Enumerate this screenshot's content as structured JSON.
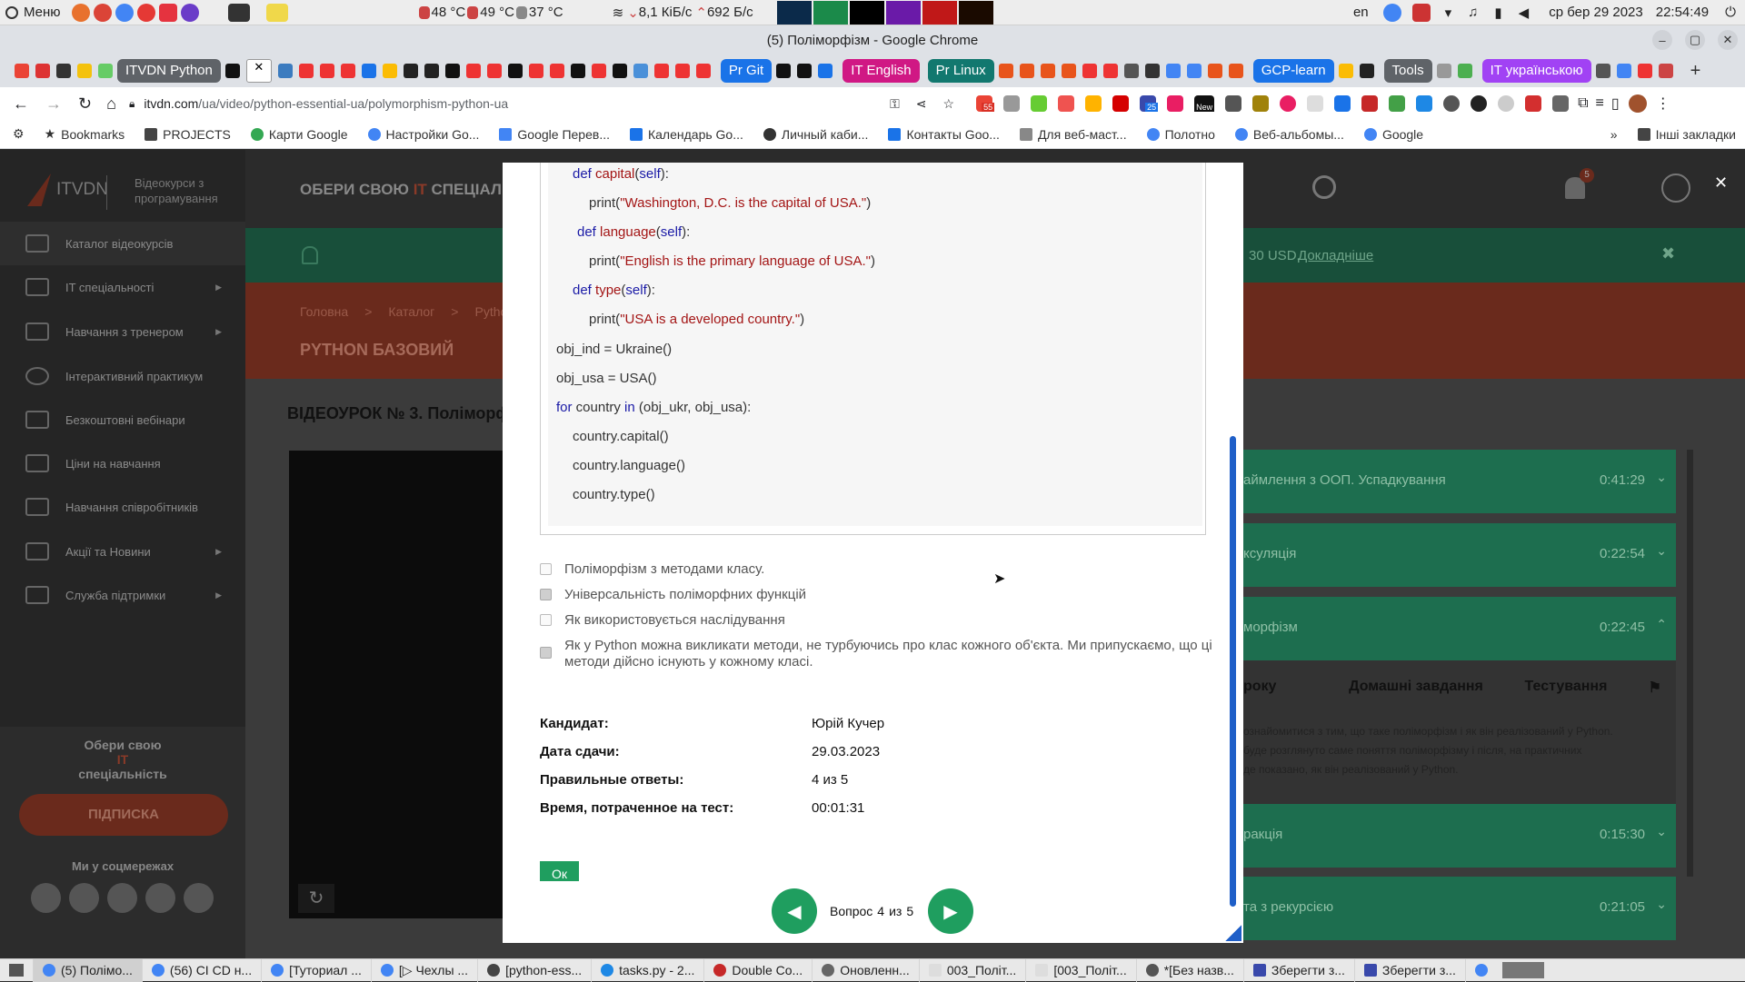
{
  "os_bar": {
    "menu_label": "Меню",
    "temp1": "48 °C",
    "temp2": "49 °C",
    "temp3": "37 °C",
    "net_down": "8,1 КіБ/с",
    "net_up": "692 Б/с",
    "lang": "en",
    "datetime": "ср бер 29 2023",
    "clock": "22:54:49"
  },
  "window": {
    "title": "(5) Поліморфізм - Google Chrome"
  },
  "tabs": {
    "itvdn_python": "ITVDN Python",
    "pr_git": "Pr Git",
    "it_english": "IT English",
    "pr_linux": "Pr Linux",
    "gcp_learn": "GCP-learn",
    "tools": "Tools",
    "it_ukr": "IT українською"
  },
  "address": {
    "host": "itvdn.com",
    "path": "/ua/video/python-essential-ua/polymorphism-python-ua",
    "badge_55": "55",
    "badge_25": "25",
    "badge_new": "New"
  },
  "bookmarks": {
    "items": [
      "Bookmarks",
      "PROJECTS",
      "Карти Google",
      "Настройки Go...",
      "Google Перев...",
      "Календарь Go...",
      "Личный каби...",
      "Контакты Goo...",
      "Для веб-маст...",
      "Полотно",
      "Веб-альбомы...",
      "Google"
    ],
    "more": "»",
    "other": "Інші закладки"
  },
  "site": {
    "logo": "ITVDN",
    "logo_sub": "Відеокурси з програмування",
    "choose_spec": "ОБЕРИ СВОЮ",
    "choose_it": "IT",
    "choose_rest": "СПЕЦІАЛЬН",
    "notif_count": "5",
    "promo_tail": "30 USD.",
    "promo_link": "Докладніше",
    "breadcrumb": [
      "Головна",
      "Каталог",
      "Python E"
    ],
    "course_title": "PYTHON БАЗОВИЙ",
    "lesson_title": "ВІДЕОУРОК № 3. Поліморфі",
    "sidebar": [
      "Каталог відеокурсів",
      "IT спеціальності",
      "Навчання з тренером",
      "Інтерактивний практикум",
      "Безкоштовні вебінари",
      "Ціни на навчання",
      "Навчання співробітників",
      "Акції та Новини",
      "Служба підтримки"
    ],
    "choose_block": [
      "Обери свою",
      "IT",
      "спеціальність"
    ],
    "subscribe": "ПІДПИСКА",
    "social_label": "Ми у соцмережах",
    "lessons": [
      {
        "title": "аймлення з ООП. Успадкування",
        "duration": "0:41:29"
      },
      {
        "title": "ксуляція",
        "duration": "0:22:54"
      },
      {
        "title": "морфізм",
        "duration": "0:22:45"
      },
      {
        "title": "ракція",
        "duration": "0:15:30"
      },
      {
        "title": "та з рекурсією",
        "duration": "0:21:05"
      }
    ],
    "lesson_tabs": [
      "року",
      "Домашні завдання",
      "Тестування"
    ],
    "lesson_desc": [
      "ознайомитися з тим, що таке поліморфізм і як він реалізований у Python.",
      "буде розглянуто саме поняття поліморфізму і після, на практичних",
      "де показано, як він реалізований у Python."
    ]
  },
  "code": {
    "lines": [
      {
        "kw": "def ",
        "fn": "capital",
        "rest_open": "(",
        "self": "self",
        "rest_close": "):"
      },
      {
        "plain": "print(",
        "str": "\"Washington, D.C. is the capital of USA.\"",
        "end": ")"
      },
      {
        "kw": "def ",
        "fn": "language",
        "rest_open": "(",
        "self": "self",
        "rest_close": "):"
      },
      {
        "plain": "print(",
        "str": "\"English is the primary language of USA.\"",
        "end": ")"
      },
      {
        "kw": "def ",
        "fn": "type",
        "rest_open": "(",
        "self": "self",
        "rest_close": "):"
      },
      {
        "plain": "print(",
        "str": "\"USA is a developed country.\"",
        "end": ")"
      },
      {
        "text": "obj_ind = Ukraine()"
      },
      {
        "text": "obj_usa = USA()"
      },
      {
        "kw": "for",
        "mid": " country ",
        "kw2": "in",
        "rest": " (obj_ukr, obj_usa):"
      },
      {
        "text": "country.capital()"
      },
      {
        "text": "country.language()"
      },
      {
        "text": "country.type()"
      }
    ]
  },
  "answers": [
    {
      "text": "Поліморфізм з методами класу.",
      "checked": false
    },
    {
      "text": "Універсальність поліморфних функцій",
      "checked": true
    },
    {
      "text": "Як використовується наслідування",
      "checked": false
    },
    {
      "text": "Як у Python можна викликати методи, не турбуючись про клас кожного об'єкта. Ми припускаємо, що ці методи дійсно існують у кожному класі.",
      "checked": true
    }
  ],
  "result": {
    "candidate_label": "Кандидат:",
    "candidate": "Юрій Кучер",
    "date_label": "Дата сдачи:",
    "date": "29.03.2023",
    "correct_label": "Правильные ответы:",
    "correct": "4 из 5",
    "time_label": "Время, потраченное на тест:",
    "time": "00:01:31",
    "ok": "Ок"
  },
  "pager": {
    "text": "Вопрос",
    "current": "4",
    "of": "из",
    "total": "5"
  },
  "taskbar": [
    "(5) Полімо...",
    "(56) CI CD н...",
    "[Туториал ...",
    "[▷ Чехлы ...",
    "[python-ess...",
    "tasks.py - 2...",
    "Double Co...",
    "Оновленн...",
    "003_Політ...",
    "[003_Політ...",
    "*[Без назв...",
    "Зберегти з...",
    "Зберегти з..."
  ],
  "colors": {
    "green": "#1f9e5f",
    "orange": "#c8402a",
    "teal": "#1d6e4f"
  }
}
